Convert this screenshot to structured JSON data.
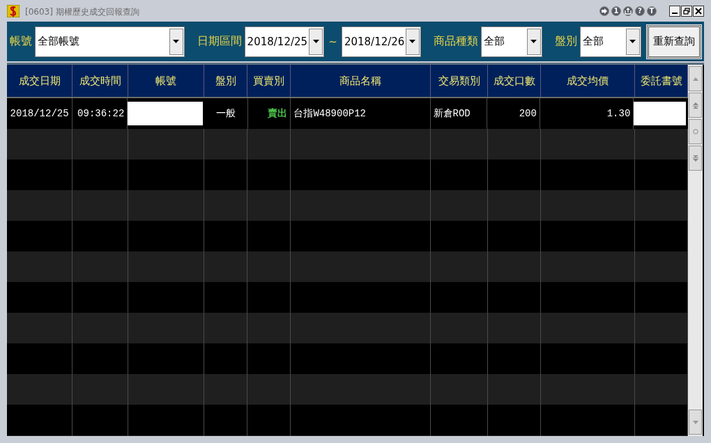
{
  "window": {
    "title": "[0603] 期權歷史成交回報查詢",
    "title_buttons": [
      {
        "kind": "icon"
      },
      {
        "kind": "text",
        "label": "1"
      },
      {
        "kind": "icon"
      },
      {
        "kind": "text",
        "label": "?"
      },
      {
        "kind": "text",
        "label": "T"
      }
    ]
  },
  "filters": [
    {
      "kind": "combo",
      "label": "帳號",
      "value": "全部帳號"
    },
    {
      "kind": "combo",
      "label": "日期區間",
      "value": "2018/12/25"
    },
    {
      "kind": "sep",
      "label": "~"
    },
    {
      "kind": "combo",
      "value": "2018/12/26"
    },
    {
      "kind": "combo",
      "label": "商品種類",
      "value": "全部"
    },
    {
      "kind": "combo",
      "label": "盤別",
      "value": "全部"
    },
    {
      "kind": "button",
      "label": "重新查詢"
    }
  ],
  "table": {
    "columns": [
      "成交日期",
      "成交時間",
      "帳號",
      "盤別",
      "買賣別",
      "商品名稱",
      "交易類別",
      "成交口數",
      "成交均價",
      "委託書號"
    ],
    "rows": [
      {
        "cells": [
          {
            "kind": "text",
            "text": "2018/12/25"
          },
          {
            "kind": "text",
            "text": "09:36:22"
          },
          {
            "kind": "redacted"
          },
          {
            "kind": "text",
            "text": "一般"
          },
          {
            "kind": "text",
            "text": "賣出",
            "color": "#4cc34c"
          },
          {
            "kind": "text",
            "text": "台指W48900P12"
          },
          {
            "kind": "text",
            "text": "新倉ROD"
          },
          {
            "kind": "text",
            "text": "200"
          },
          {
            "kind": "text",
            "text": "1.30"
          },
          {
            "kind": "redacted"
          }
        ]
      }
    ]
  }
}
